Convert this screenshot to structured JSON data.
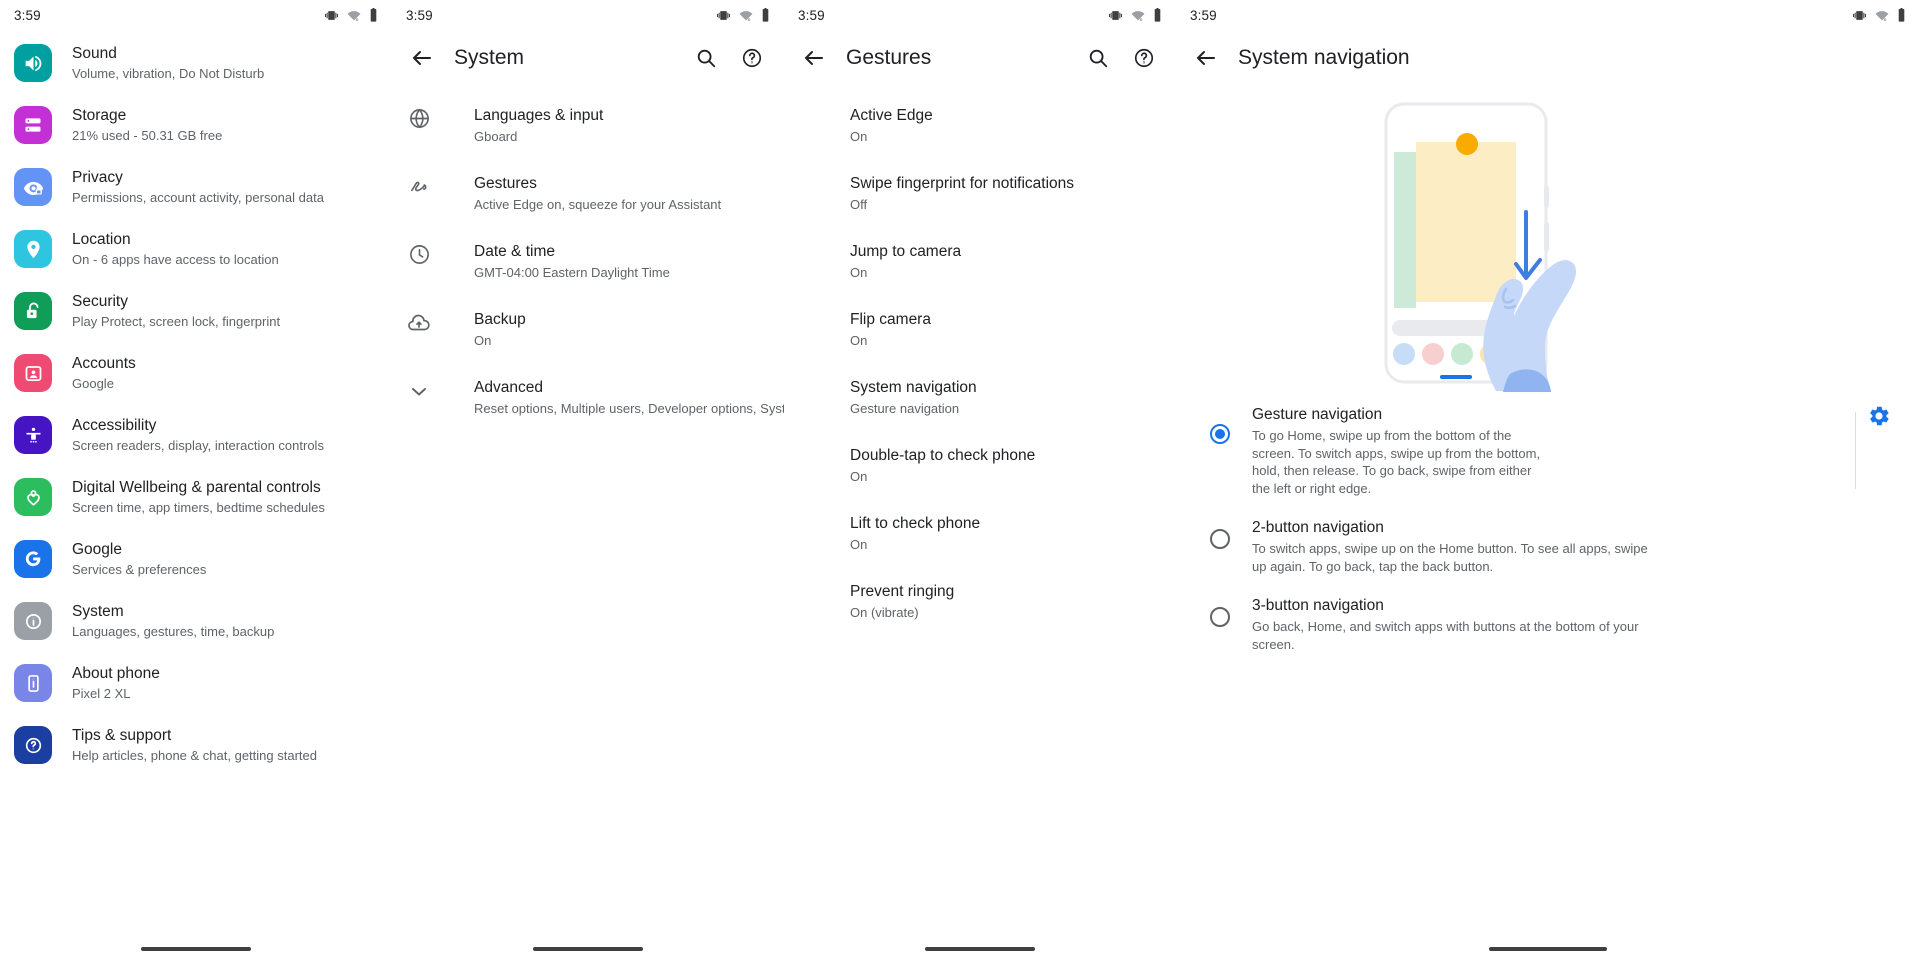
{
  "statusbar": {
    "time": "3:59",
    "icons": [
      "vibrate-icon",
      "wifi-off-icon",
      "battery-icon"
    ]
  },
  "panel_settings": {
    "items": [
      {
        "title": "Sound",
        "subtitle": "Volume, vibration, Do Not Disturb",
        "icon": "speaker-icon",
        "color": "#00a0a0"
      },
      {
        "title": "Storage",
        "subtitle": "21% used - 50.31 GB free",
        "icon": "storage-icon",
        "color": "#c230d6"
      },
      {
        "title": "Privacy",
        "subtitle": "Permissions, account activity, personal data",
        "icon": "eye-lock-icon",
        "color": "#6394f5"
      },
      {
        "title": "Location",
        "subtitle": "On - 6 apps have access to location",
        "icon": "location-pin-icon",
        "color": "#2ec5e0"
      },
      {
        "title": "Security",
        "subtitle": "Play Protect, screen lock, fingerprint",
        "icon": "unlock-icon",
        "color": "#0f9d58"
      },
      {
        "title": "Accounts",
        "subtitle": "Google",
        "icon": "account-icon",
        "color": "#ef4a72"
      },
      {
        "title": "Accessibility",
        "subtitle": "Screen readers, display, interaction controls",
        "icon": "accessibility-icon",
        "color": "#4714c4"
      },
      {
        "title": "Digital Wellbeing & parental controls",
        "subtitle": "Screen time, app timers, bedtime schedules",
        "icon": "wellbeing-heart-icon",
        "color": "#2bbd5e"
      },
      {
        "title": "Google",
        "subtitle": "Services & preferences",
        "icon": "google-g-icon",
        "color": "#1a73e8"
      },
      {
        "title": "System",
        "subtitle": "Languages, gestures, time, backup",
        "icon": "info-icon",
        "color": "#9aa0a6"
      },
      {
        "title": "About phone",
        "subtitle": "Pixel 2 XL",
        "icon": "phone-info-icon",
        "color": "#7986e8"
      },
      {
        "title": "Tips & support",
        "subtitle": "Help articles, phone & chat, getting started",
        "icon": "question-icon",
        "color": "#1b3fa0"
      }
    ]
  },
  "panel_system": {
    "title": "System",
    "back_label": "back-arrow",
    "actions": [
      "search-icon",
      "help-icon"
    ],
    "items": [
      {
        "title": "Languages & input",
        "subtitle": "Gboard",
        "icon": "globe-icon"
      },
      {
        "title": "Gestures",
        "subtitle": "Active Edge on, squeeze for your Assistant",
        "icon": "gesture-squiggle-icon"
      },
      {
        "title": "Date & time",
        "subtitle": "GMT-04:00 Eastern Daylight Time",
        "icon": "clock-icon"
      },
      {
        "title": "Backup",
        "subtitle": "On",
        "icon": "cloud-upload-icon"
      },
      {
        "title": "Advanced",
        "subtitle": "Reset options, Multiple users, Developer options, System up..",
        "icon": "chevron-down-icon"
      }
    ]
  },
  "panel_gestures": {
    "title": "Gestures",
    "actions": [
      "search-icon",
      "help-icon"
    ],
    "items": [
      {
        "title": "Active Edge",
        "subtitle": "On"
      },
      {
        "title": "Swipe fingerprint for notifications",
        "subtitle": "Off"
      },
      {
        "title": "Jump to camera",
        "subtitle": "On"
      },
      {
        "title": "Flip camera",
        "subtitle": "On"
      },
      {
        "title": "System navigation",
        "subtitle": "Gesture navigation"
      },
      {
        "title": "Double-tap to check phone",
        "subtitle": "On"
      },
      {
        "title": "Lift to check phone",
        "subtitle": "On"
      },
      {
        "title": "Prevent ringing",
        "subtitle": "On (vibrate)"
      }
    ]
  },
  "panel_navigation": {
    "title": "System navigation",
    "illustration": "hand-swiping-phone-illustration",
    "options": [
      {
        "label": "Gesture navigation",
        "description": "To go Home, swipe up from the bottom of the screen. To switch apps, swipe up from the bottom, hold, then release. To go back, swipe from either the left or right edge.",
        "selected": true,
        "has_settings": true,
        "settings_icon": "gear-icon"
      },
      {
        "label": "2-button navigation",
        "description": "To switch apps, swipe up on the Home button. To see all apps, swipe up again. To go back, tap the back button.",
        "selected": false,
        "has_settings": false
      },
      {
        "label": "3-button navigation",
        "description": "Go back, Home, and switch apps with buttons at the bottom of your screen.",
        "selected": false,
        "has_settings": false
      }
    ]
  },
  "colors": {
    "accent": "#1a73e8",
    "text_primary": "#202124",
    "text_secondary": "#5f6368",
    "divider": "#dadce0"
  }
}
